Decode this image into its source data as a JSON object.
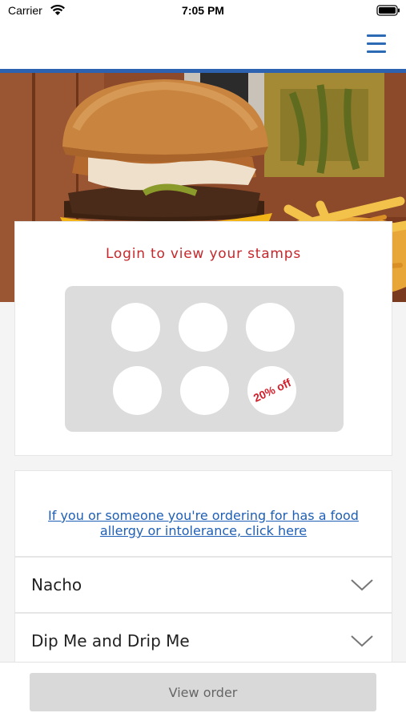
{
  "status_bar": {
    "carrier": "Carrier",
    "time": "7:05 PM"
  },
  "nav": {
    "menu_icon": "hamburger-menu-icon",
    "accent_color": "#2d62b0"
  },
  "stamp_card": {
    "title": "Login to view your stamps",
    "title_color": "#c7272b",
    "stamps_total": 6,
    "stamps_collected": 0,
    "reward_label": "20% off"
  },
  "allergy": {
    "link_text": "If you or someone you're ordering for has a food allergy or intolerance, click here"
  },
  "menu_sections": [
    {
      "label": "Nacho",
      "icon": "chevron-down-icon"
    },
    {
      "label": "Dip Me and Drip Me",
      "icon": "chevron-down-icon"
    }
  ],
  "bottom": {
    "view_order_label": "View order"
  }
}
